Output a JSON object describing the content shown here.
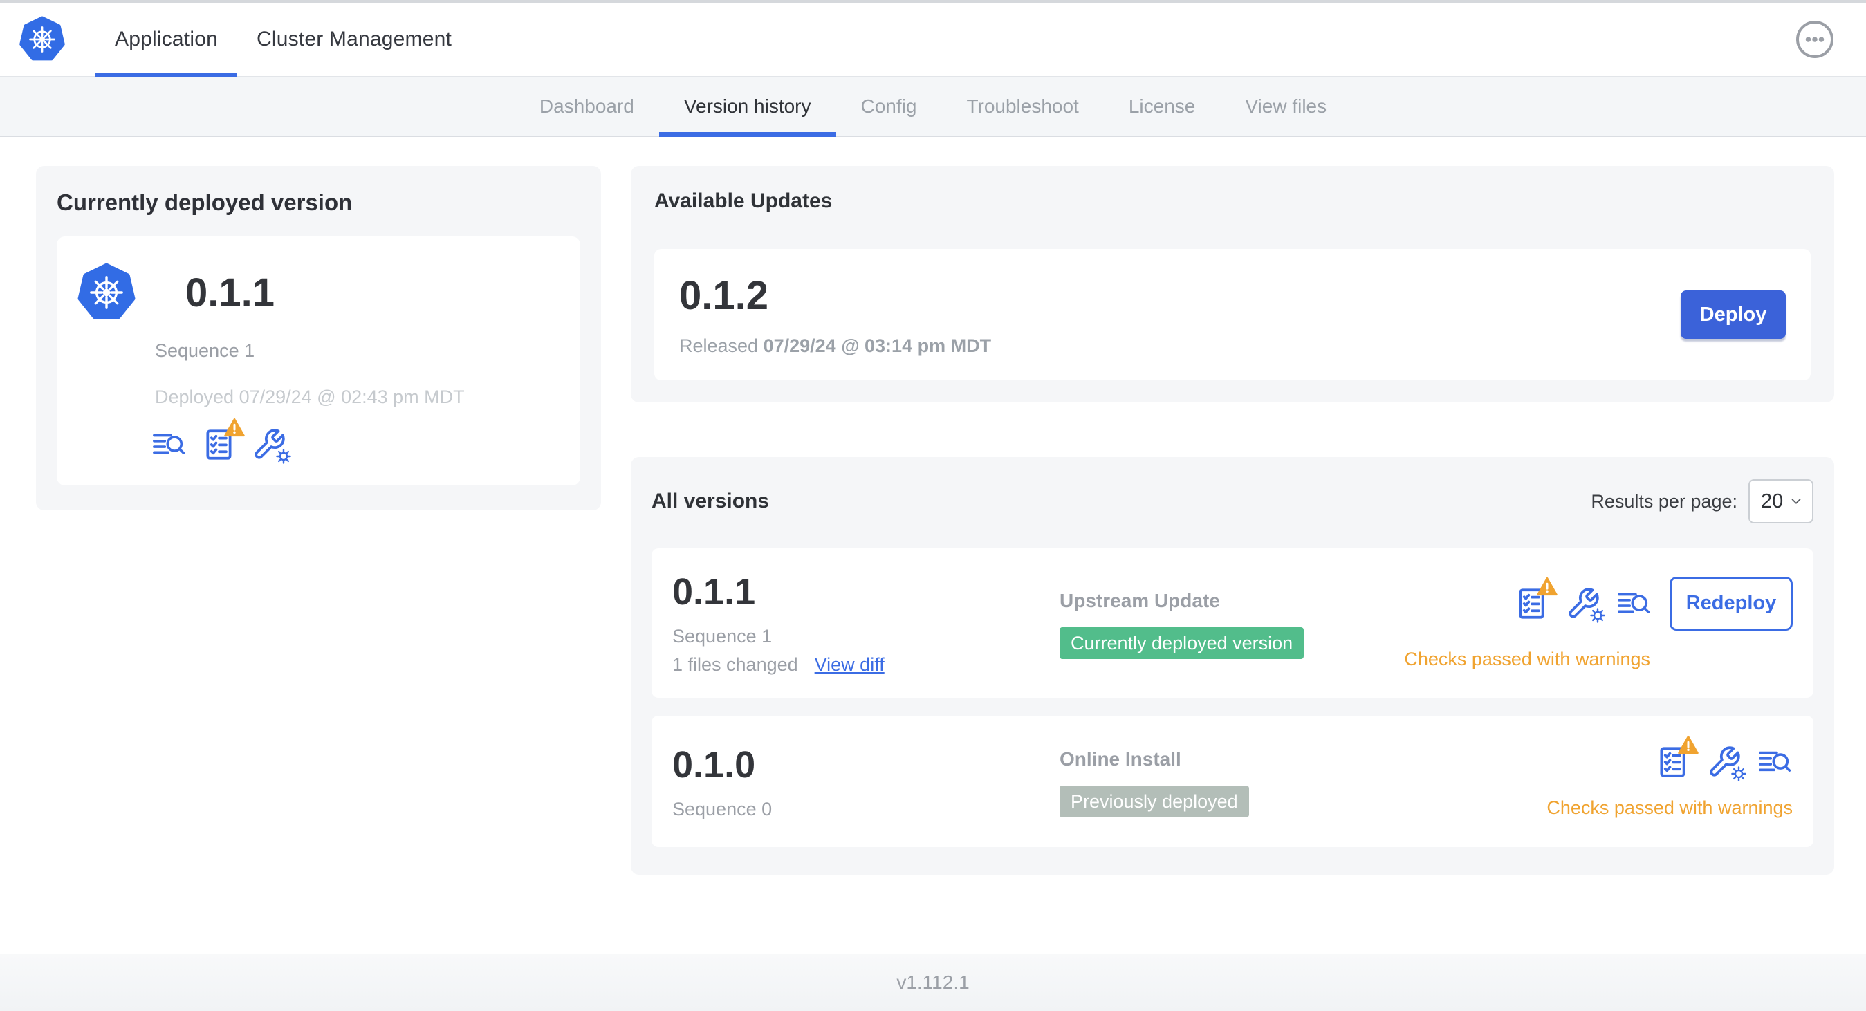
{
  "header": {
    "logo_icon": "kubernetes-logo",
    "tabs": [
      {
        "label": "Application",
        "active": true
      },
      {
        "label": "Cluster Management",
        "active": false
      }
    ],
    "menu_icon": "ellipsis-icon"
  },
  "subnav": {
    "tabs": [
      {
        "label": "Dashboard",
        "active": false
      },
      {
        "label": "Version history",
        "active": true
      },
      {
        "label": "Config",
        "active": false
      },
      {
        "label": "Troubleshoot",
        "active": false
      },
      {
        "label": "License",
        "active": false
      },
      {
        "label": "View files",
        "active": false
      }
    ]
  },
  "current_version_panel": {
    "title": "Currently deployed version",
    "version": "0.1.1",
    "sequence": "Sequence 1",
    "deployed": "Deployed 07/29/24 @ 02:43 pm MDT",
    "icons": [
      "deploy-logs-icon",
      "preflight-checks-warning-icon",
      "config-icon"
    ]
  },
  "available_updates": {
    "title": "Available Updates",
    "version": "0.1.2",
    "released_prefix": "Released",
    "released_date": "07/29/24 @ 03:14 pm MDT",
    "deploy_label": "Deploy"
  },
  "all_versions": {
    "title": "All versions",
    "results_per_page_label": "Results per page:",
    "results_per_page_value": "20",
    "rows": [
      {
        "version": "0.1.1",
        "sequence": "Sequence 1",
        "files_changed": "1 files changed",
        "view_diff_label": "View diff",
        "source": "Upstream Update",
        "badge": "Currently deployed version",
        "badge_color": "#52bd8b",
        "icons": [
          "preflight-checks-warning-icon",
          "config-icon",
          "deploy-logs-icon"
        ],
        "status": "Checks passed with warnings",
        "action_label": "Redeploy"
      },
      {
        "version": "0.1.0",
        "sequence": "Sequence 0",
        "source": "Online Install",
        "badge": "Previously deployed",
        "badge_color": "#b3beb8",
        "icons": [
          "preflight-checks-warning-icon",
          "config-icon",
          "deploy-logs-icon"
        ],
        "status": "Checks passed with warnings"
      }
    ]
  },
  "footer": {
    "version": "v1.112.1"
  },
  "colors": {
    "accent_blue": "#3b6ce4",
    "deploy_button_blue": "#3b62d9",
    "badge_green": "#52bd8b",
    "badge_gray": "#b3beb8",
    "warning_amber": "#f0a330",
    "panel_gray": "#f5f6f8",
    "muted_text": "#9b9fa6",
    "faint_text": "#c6cace"
  }
}
